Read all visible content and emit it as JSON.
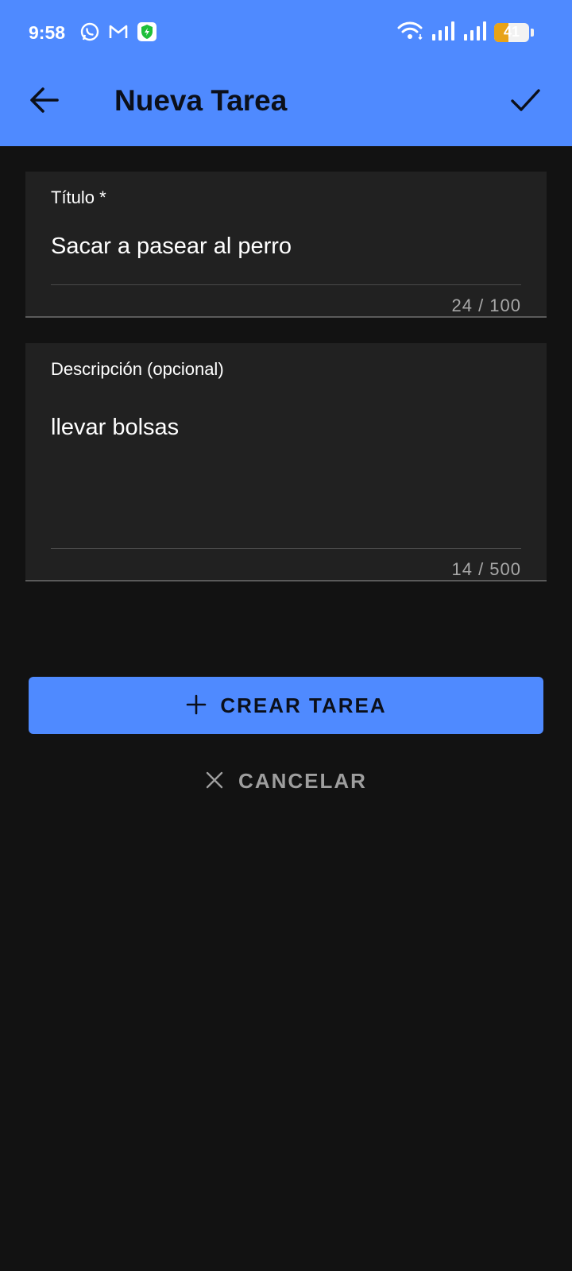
{
  "status_bar": {
    "time": "9:58",
    "battery_level": "41",
    "battery_fraction": 0.41,
    "icons": [
      "whatsapp-icon",
      "gmail-icon",
      "shield-icon",
      "wifi-icon",
      "signal-icon",
      "signal-icon",
      "battery-icon"
    ]
  },
  "toolbar": {
    "title": "Nueva Tarea",
    "back_icon": "arrow-back-icon",
    "confirm_icon": "check-icon"
  },
  "form": {
    "title_field": {
      "label": "Título *",
      "value": "Sacar a pasear al perro",
      "counter": "24 / 100"
    },
    "description_field": {
      "label": "Descripción (opcional)",
      "value": "llevar bolsas",
      "counter": "14 / 500"
    }
  },
  "actions": {
    "create_label": "CREAR TAREA",
    "create_icon": "plus-icon",
    "cancel_label": "CANCELAR",
    "cancel_icon": "close-icon"
  },
  "colors": {
    "accent": "#4f8aff",
    "background": "#121212",
    "surface": "#212121",
    "battery": "#e8a317"
  }
}
